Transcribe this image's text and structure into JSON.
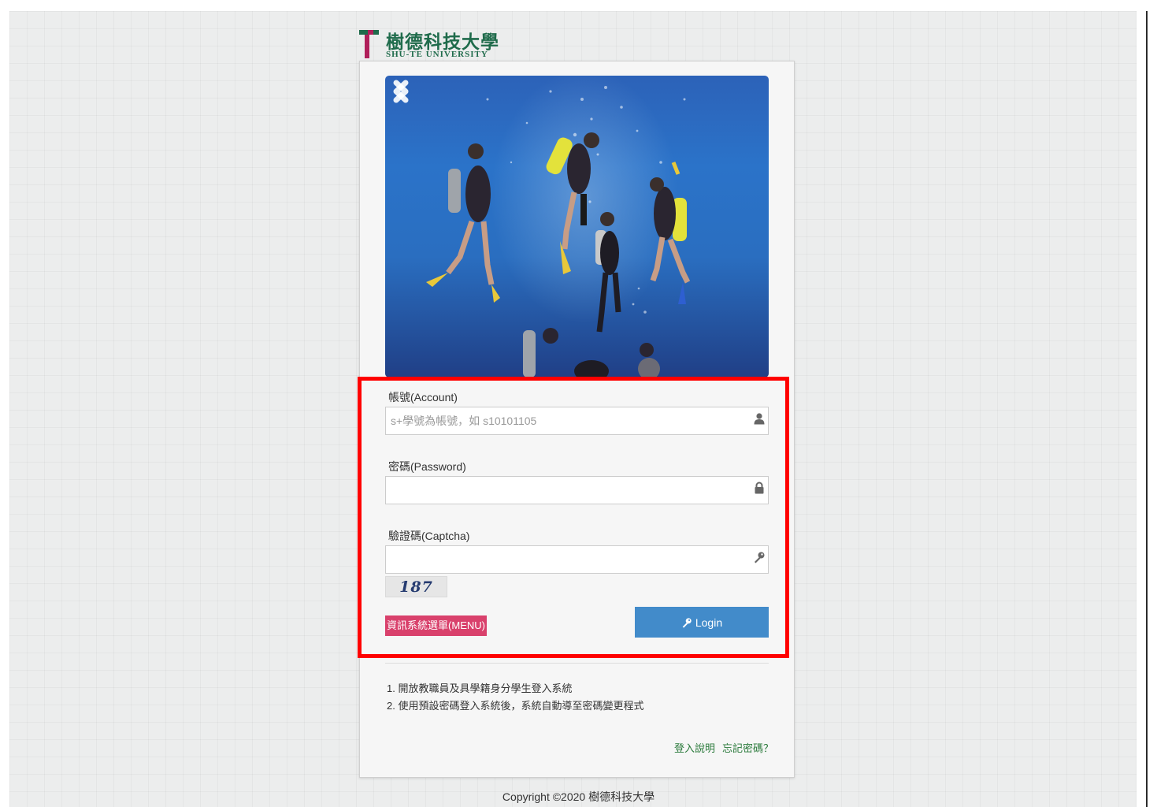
{
  "brand": {
    "name_zh": "樹德科技大學",
    "name_en": "SHU-TE UNIVERSITY"
  },
  "carousel": {
    "prev_icon": "chevron-left-icon",
    "next_icon": "chevron-right-icon"
  },
  "form": {
    "account_label": "帳號(Account)",
    "account_placeholder": "s+學號為帳號，如 s10101105",
    "account_value": "",
    "password_label": "密碼(Password)",
    "password_value": "",
    "captcha_label": "驗證碼(Captcha)",
    "captcha_value": "",
    "captcha_image_text": "187",
    "menu_button": "資訊系統選單(MENU)",
    "login_button": "Login"
  },
  "notes": [
    "1. 開放教職員及具學籍身分學生登入系統",
    "2. 使用預設密碼登入系統後，系統自動導至密碼變更程式"
  ],
  "links": {
    "login_help": "登入說明",
    "forgot_password": "忘記密碼？"
  },
  "footer": {
    "copyright": "Copyright ©2020 樹德科技大學"
  },
  "colors": {
    "highlight": "#ff0000",
    "brand_green": "#1f6b4b",
    "brand_magenta": "#b01f5a",
    "login_button": "#428bca",
    "menu_button": "#d9416c",
    "link": "#2a7a3b"
  },
  "icons": {
    "account": "user-icon",
    "password": "lock-icon",
    "captcha": "key-icon",
    "login": "key-icon"
  }
}
